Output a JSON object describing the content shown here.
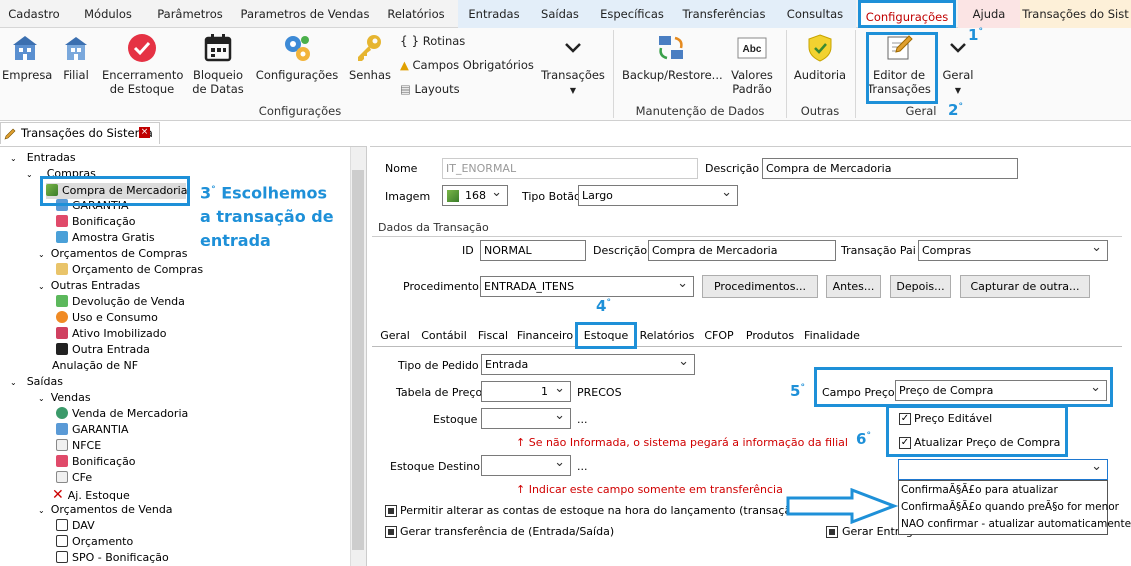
{
  "menu": [
    "Cadastro",
    "Módulos",
    "Parâmetros",
    "Parametros de Vendas",
    "Relatórios",
    "Entradas",
    "Saídas",
    "Específicas",
    "Transferências",
    "Consultas",
    "Configurações",
    "Ajuda",
    "Transações do Sist"
  ],
  "ribbon": {
    "empresa": "Empresa",
    "filial": "Filial",
    "encerramento": "Encerramento",
    "de_estoque": "de Estoque",
    "bloqueio": "Bloqueio",
    "de_datas": "de Datas",
    "configuracoes": "Configurações",
    "senhas": "Senhas",
    "rotinas": "Rotinas",
    "campos_obrigatorios": "Campos Obrigatórios",
    "layouts": "Layouts",
    "transacoes": "Transações",
    "backup": "Backup/Restore...",
    "valores": "Valores",
    "padrao": "Padrão",
    "auditoria": "Auditoria",
    "editor_de": "Editor de",
    "transacoes2": "Transações",
    "geral": "Geral",
    "grp_configuracoes": "Configurações",
    "grp_manutencao": "Manutenção de Dados",
    "grp_outras": "Outras",
    "grp_geral": "Geral"
  },
  "doc_tab": "Transações do Sistema",
  "tree": {
    "entradas": "Entradas",
    "compras": "Compras",
    "compra_mercadoria": "Compra de Mercadoria",
    "garantia": "GARANTIA",
    "bonificacao": "Bonificação",
    "amostra": "Amostra Gratis",
    "orc_compras": "Orçamentos de Compras",
    "orc_compras_item": "Orçamento de Compras",
    "outras_entradas": "Outras Entradas",
    "devolucao": "Devolução de Venda",
    "uso_consumo": "Uso e Consumo",
    "ativo": "Ativo Imobilizado",
    "outra_entrada": "Outra Entrada",
    "anulacao": "Anulação de NF",
    "saidas": "Saídas",
    "vendas": "Vendas",
    "venda_mercadoria": "Venda de Mercadoria",
    "garantia2": "GARANTIA",
    "nfce": "NFCE",
    "bonificacao2": "Bonificação",
    "cfe": "CFe",
    "aj_estoque": "Aj. Estoque",
    "orc_venda": "Orçamentos de Venda",
    "dav": "DAV",
    "orcamento": "Orçamento",
    "spo": "SPO - Bonificação"
  },
  "form": {
    "nome_lbl": "Nome",
    "nome_val": "IT_ENORMAL",
    "descricao_lbl": "Descrição",
    "descricao_val": "Compra de Mercadoria",
    "imagem_lbl": "Imagem",
    "imagem_val": "168",
    "tipo_botao_lbl": "Tipo Botão",
    "tipo_botao_val": "Largo",
    "dados_lbl": "Dados da Transação",
    "id_lbl": "ID",
    "id_val": "NORMAL",
    "desc2_lbl": "Descrição",
    "desc2_val": "Compra de Mercadoria",
    "pai_lbl": "Transação Pai",
    "pai_val": "Compras",
    "proc_lbl": "Procedimento",
    "proc_val": "ENTRADA_ITENS",
    "btn_proc": "Procedimentos...",
    "btn_antes": "Antes...",
    "btn_depois": "Depois...",
    "btn_capturar": "Capturar de outra...",
    "tabs": [
      "Geral",
      "Contábil",
      "Fiscal",
      "Financeiro",
      "Estoque",
      "Relatórios",
      "CFOP",
      "Produtos",
      "Finalidade"
    ],
    "tipo_pedido_lbl": "Tipo de Pedido",
    "tipo_pedido_val": "Entrada",
    "tabela_lbl": "Tabela de Preço",
    "tabela_val": "1",
    "tabela_nome": "PRECOS",
    "estoque_lbl": "Estoque",
    "ellipsis": "...",
    "aviso1": "↑ Se não Informada, o sistema pegará a informação da filial",
    "estoque_destino_lbl": "Estoque Destino",
    "aviso2": "↑ Indicar este campo somente em transferência",
    "permitir": "Permitir alterar as contas de estoque na hora do lançamento (transação)...",
    "gerar_transf": "Gerar transferência de (Entrada/Saída)",
    "gerar_entrega": "Gerar Entreg",
    "campo_preco_lbl": "Campo Preço",
    "campo_preco_val": "Preço de Compra",
    "preco_editavel": "Preço Editável",
    "atualizar_preco": "Atualizar Preço de Compra",
    "dd_items": [
      "ConfirmaÃ§Ã£o para atualizar",
      "ConfirmaÃ§Ã£o quando preÃ§o for menor",
      "NAO confirmar - atualizar automaticamente"
    ]
  },
  "annotations": {
    "a1": "1",
    "a2": "2",
    "a3a": "3",
    "a3b": "Escolhemos",
    "a3c": "a transação de",
    "a3d": "entrada",
    "a4": "4",
    "a5": "5",
    "a6": "6",
    "deg": "°"
  }
}
